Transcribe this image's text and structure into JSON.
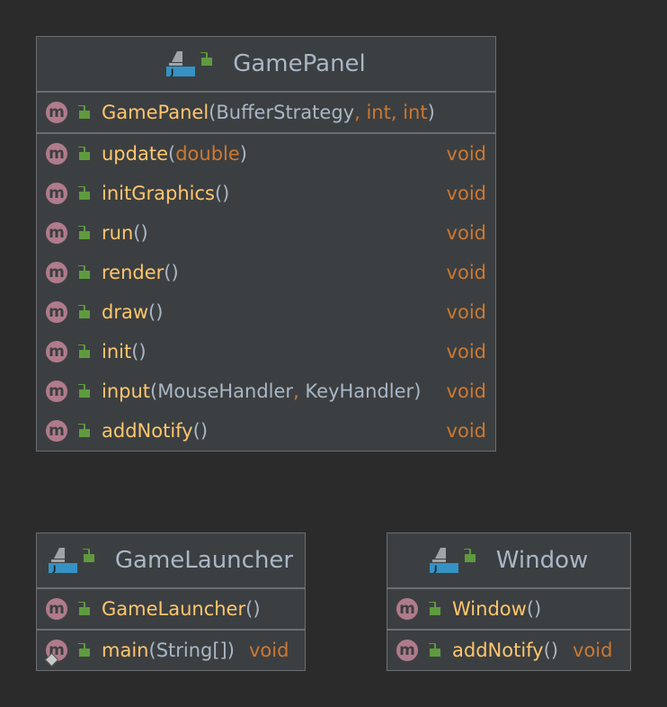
{
  "classes": [
    {
      "name": "GamePanel",
      "constructors": [
        {
          "name": "GamePanel",
          "params": [
            "BufferStrategy",
            "int",
            "int"
          ],
          "param_kinds": [
            "type",
            "kw",
            "kw"
          ]
        }
      ],
      "methods": [
        {
          "name": "update",
          "params": [
            "double"
          ],
          "param_kinds": [
            "kw"
          ],
          "ret": "void"
        },
        {
          "name": "initGraphics",
          "params": [],
          "ret": "void"
        },
        {
          "name": "run",
          "params": [],
          "ret": "void"
        },
        {
          "name": "render",
          "params": [],
          "ret": "void"
        },
        {
          "name": "draw",
          "params": [],
          "ret": "void"
        },
        {
          "name": "init",
          "params": [],
          "ret": "void"
        },
        {
          "name": "input",
          "params": [
            "MouseHandler",
            "KeyHandler"
          ],
          "param_kinds": [
            "type",
            "type"
          ],
          "ret": "void"
        },
        {
          "name": "addNotify",
          "params": [],
          "ret": "void"
        }
      ]
    },
    {
      "name": "GameLauncher",
      "constructors": [
        {
          "name": "GameLauncher",
          "params": []
        }
      ],
      "methods": [
        {
          "name": "main",
          "params": [
            "String[]"
          ],
          "param_kinds": [
            "type"
          ],
          "ret": "void",
          "static": true
        }
      ]
    },
    {
      "name": "Window",
      "constructors": [
        {
          "name": "Window",
          "params": []
        }
      ],
      "methods": [
        {
          "name": "addNotify",
          "params": [],
          "ret": "void"
        }
      ]
    }
  ],
  "icons": {
    "class_icon": "java-class-icon",
    "method_icon": "method-icon",
    "visibility_icon": "public-lock-icon",
    "method_letter": "m"
  },
  "colors": {
    "background": "#2b2b2b",
    "box": "#3c3f41",
    "method_name": "#ffc66d",
    "keyword": "#cc7832",
    "type": "#a9b7c6",
    "method_icon": "#b07b8c",
    "lock": "#5f9a3f",
    "class_icon": "#3592c4"
  }
}
